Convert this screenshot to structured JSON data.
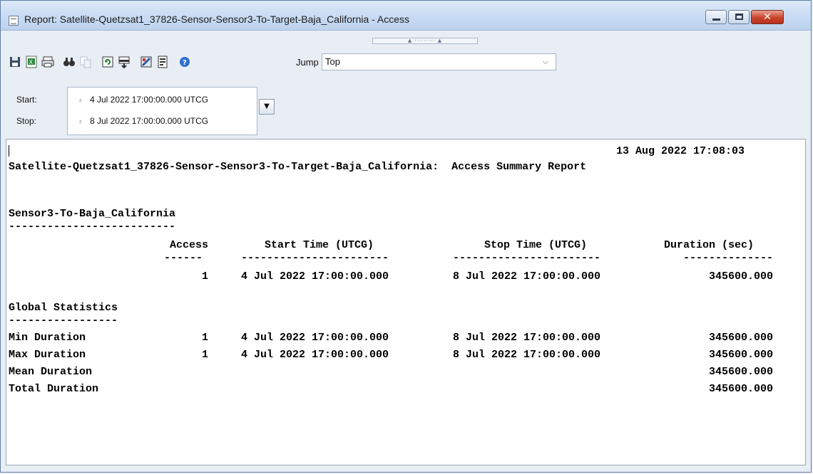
{
  "window": {
    "title": "Report: Satellite-Quetzsat1_37826-Sensor-Sensor3-To-Target-Baja_California - Access",
    "buttons": {
      "minimize": "minimize",
      "maximize": "maximize",
      "close": "close"
    }
  },
  "toolbar": {
    "icons": [
      "save-icon",
      "excel-export-icon",
      "print-icon",
      "find-icon",
      "copy-icon",
      "refresh-icon",
      "graph-icon",
      "report-style-icon",
      "report-manager-icon",
      "help-icon"
    ],
    "jump_label": "Jump",
    "jump_value": "Top"
  },
  "times": {
    "start_label": "Start:",
    "start_value": "4 Jul 2022 17:00:00.000 UTCG",
    "stop_label": "Stop:",
    "stop_value": "8 Jul 2022 17:00:00.000 UTCG"
  },
  "report": {
    "timestamp": "13 Aug 2022 17:08:03",
    "heading": "Satellite-Quetzsat1_37826-Sensor-Sensor3-To-Target-Baja_California:  Access Summary Report",
    "section_title": "Sensor3-To-Baja_California",
    "section_underline": "--------------------------",
    "columns": [
      "Access",
      "Start Time (UTCG)",
      "Stop Time (UTCG)",
      "Duration (sec)"
    ],
    "column_underlines": [
      "------",
      "-----------------------",
      "-----------------------",
      "--------------"
    ],
    "rows": [
      {
        "access": "1",
        "start": "4 Jul 2022 17:00:00.000",
        "stop": "8 Jul 2022 17:00:00.000",
        "duration": "345600.000"
      }
    ],
    "global_title": "Global Statistics",
    "global_underline": "-----------------",
    "stats": [
      {
        "label": "Min Duration",
        "access": "1",
        "start": "4 Jul 2022 17:00:00.000",
        "stop": "8 Jul 2022 17:00:00.000",
        "duration": "345600.000"
      },
      {
        "label": "Max Duration",
        "access": "1",
        "start": "4 Jul 2022 17:00:00.000",
        "stop": "8 Jul 2022 17:00:00.000",
        "duration": "345600.000"
      },
      {
        "label": "Mean Duration",
        "access": "",
        "start": "",
        "stop": "",
        "duration": "345600.000"
      },
      {
        "label": "Total Duration",
        "access": "",
        "start": "",
        "stop": "",
        "duration": "345600.000"
      }
    ]
  }
}
